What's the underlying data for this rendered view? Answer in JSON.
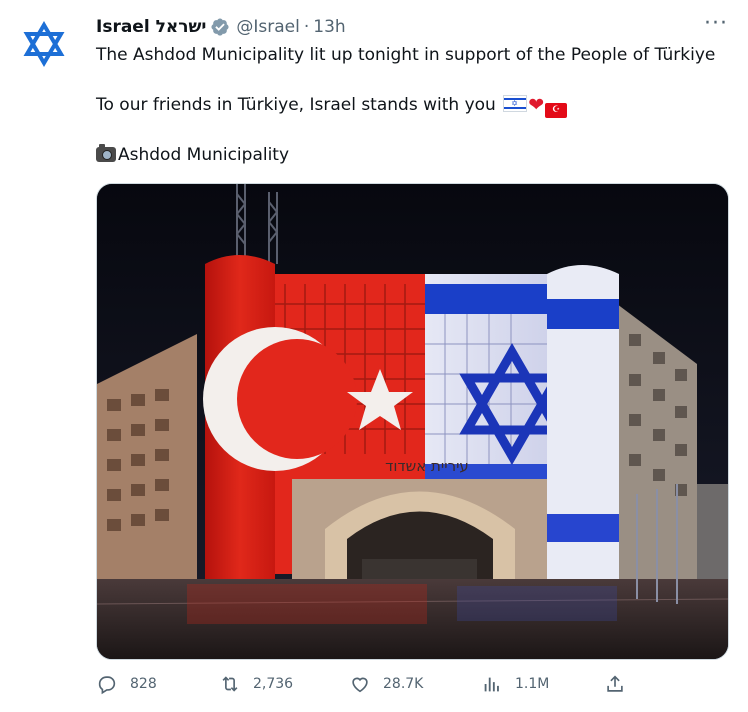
{
  "tweet": {
    "display_name": "Israel ישראל",
    "handle": "@Israel",
    "separator": "·",
    "time": "13h",
    "more_label": "···",
    "line1": "The Ashdod Municipality lit up tonight in support of the People of Türkiye",
    "line2": "To our friends in Türkiye, Israel stands with you",
    "line3": "Ashdod Municipality",
    "image_sign_text": "עיריית אשדוד"
  },
  "metrics": {
    "replies": "828",
    "retweets": "2,736",
    "likes": "28.7K",
    "views": "1.1M"
  },
  "colors": {
    "verified": "#829aab",
    "text_secondary": "#536471",
    "turkish_red": "#e30a17",
    "israeli_blue": "#1a3fc8"
  },
  "icons": [
    "star-of-david-icon",
    "verified-badge-icon",
    "more-icon",
    "camera-icon",
    "reply-icon",
    "retweet-icon",
    "like-icon",
    "views-icon",
    "share-icon"
  ]
}
